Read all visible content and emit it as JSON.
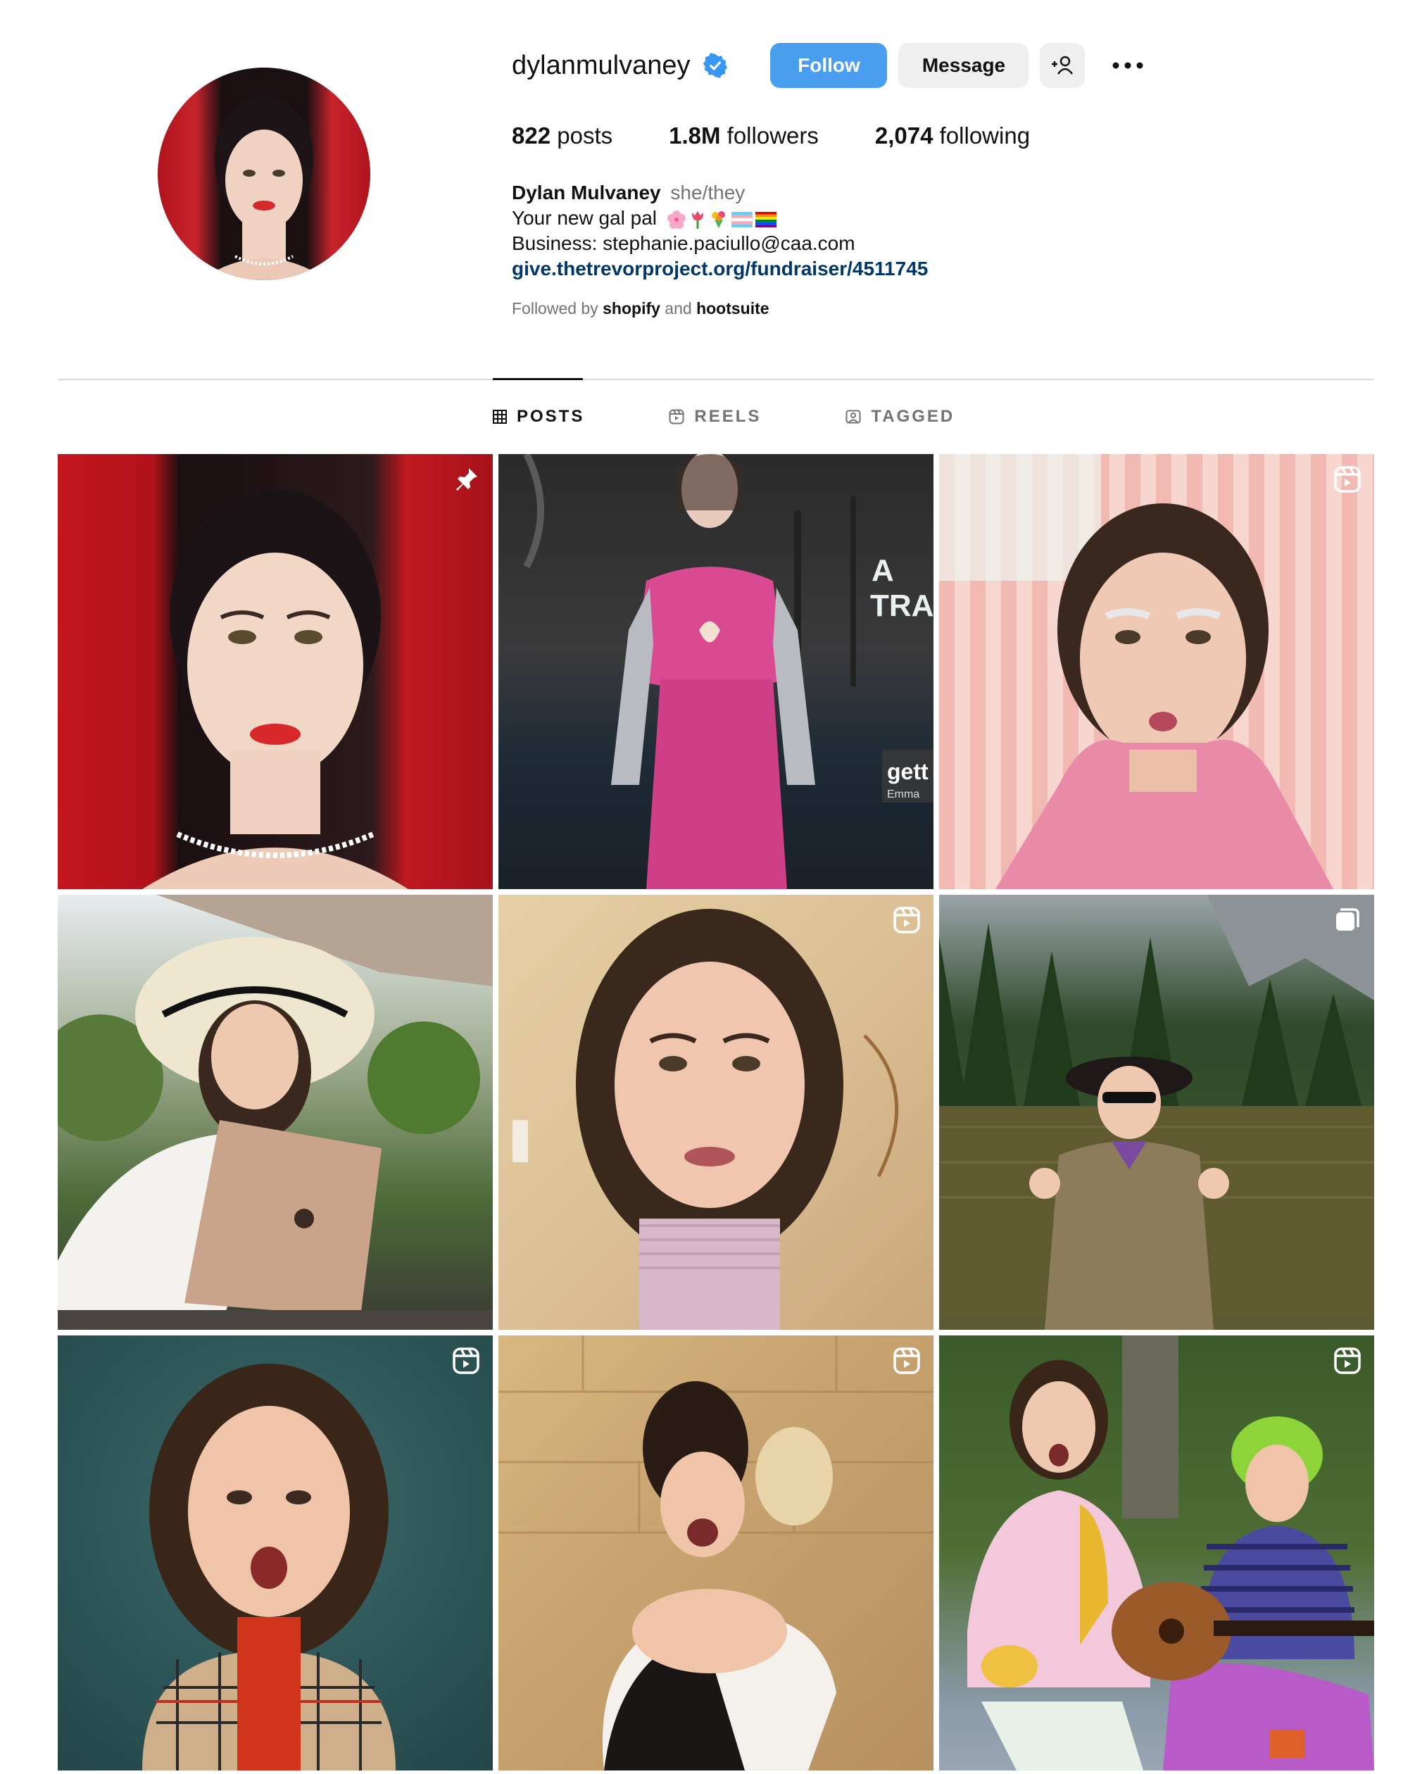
{
  "profile": {
    "username": "dylanmulvaney",
    "buttons": {
      "follow": "Follow",
      "message": "Message"
    },
    "stats": [
      {
        "count": "822",
        "label": "posts"
      },
      {
        "count": "1.8M",
        "label": "followers"
      },
      {
        "count": "2,074",
        "label": "following"
      }
    ],
    "bio": {
      "name": "Dylan Mulvaney",
      "pronouns": "she/they",
      "line1": "Your new gal pal",
      "line2": "Business: stephanie.paciullo@caa.com",
      "link": "give.thetrevorproject.org/fundraiser/4511745"
    },
    "followed_by": {
      "prefix": "Followed by",
      "user1": "shopify",
      "and": "and",
      "user2": "hootsuite"
    }
  },
  "tabs": [
    {
      "label": "POSTS",
      "icon": "grid-icon",
      "active": true
    },
    {
      "label": "REELS",
      "icon": "reels-icon",
      "active": false
    },
    {
      "label": "TAGGED",
      "icon": "tagged-icon",
      "active": false
    }
  ],
  "posts": [
    {
      "badge": "pin-icon"
    },
    {
      "badge": ""
    },
    {
      "badge": "reel-icon"
    },
    {
      "badge": ""
    },
    {
      "badge": "reel-icon"
    },
    {
      "badge": "carousel-icon"
    },
    {
      "badge": "reel-icon"
    },
    {
      "badge": "reel-icon"
    },
    {
      "badge": "reel-icon"
    }
  ],
  "colors": {
    "accent": "#4a9ef0",
    "link": "#00376b",
    "muted": "#737373"
  }
}
